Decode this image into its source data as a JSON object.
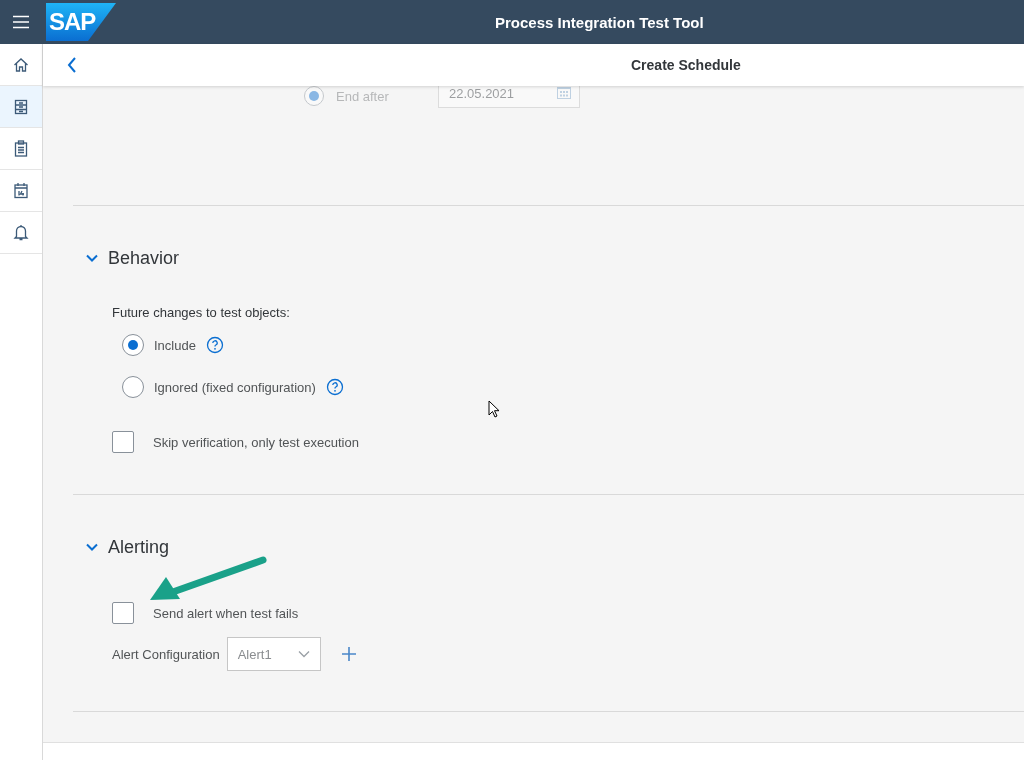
{
  "shell": {
    "logo": "SAP",
    "title": "Process Integration Test Tool"
  },
  "nav": [
    {
      "kind": "home",
      "selected": false
    },
    {
      "kind": "cabinet",
      "selected": true
    },
    {
      "kind": "clipboard",
      "selected": false
    },
    {
      "kind": "calendar",
      "selected": false
    },
    {
      "kind": "bell",
      "selected": false
    }
  ],
  "page": {
    "title": "Create Schedule"
  },
  "end_after": {
    "label": "End after",
    "selected": true,
    "date": "22.05.2021",
    "disabled": true
  },
  "sections": [
    {
      "title": "Behavior",
      "expanded": true,
      "items": [
        {
          "kind": "label",
          "text": "Future changes to test objects:"
        },
        {
          "kind": "radio",
          "label": "Include",
          "selected": true,
          "help": true
        },
        {
          "kind": "radio",
          "label": "Ignored (fixed configuration)",
          "selected": false,
          "help": true
        },
        {
          "kind": "checkbox",
          "label": "Skip verification, only test execution",
          "checked": false
        }
      ]
    },
    {
      "title": "Alerting",
      "expanded": true,
      "items": [
        {
          "kind": "checkbox",
          "label": "Send alert when test fails",
          "checked": false
        },
        {
          "kind": "select",
          "label": "Alert Configuration",
          "value": "Alert1",
          "add": true
        }
      ]
    }
  ]
}
